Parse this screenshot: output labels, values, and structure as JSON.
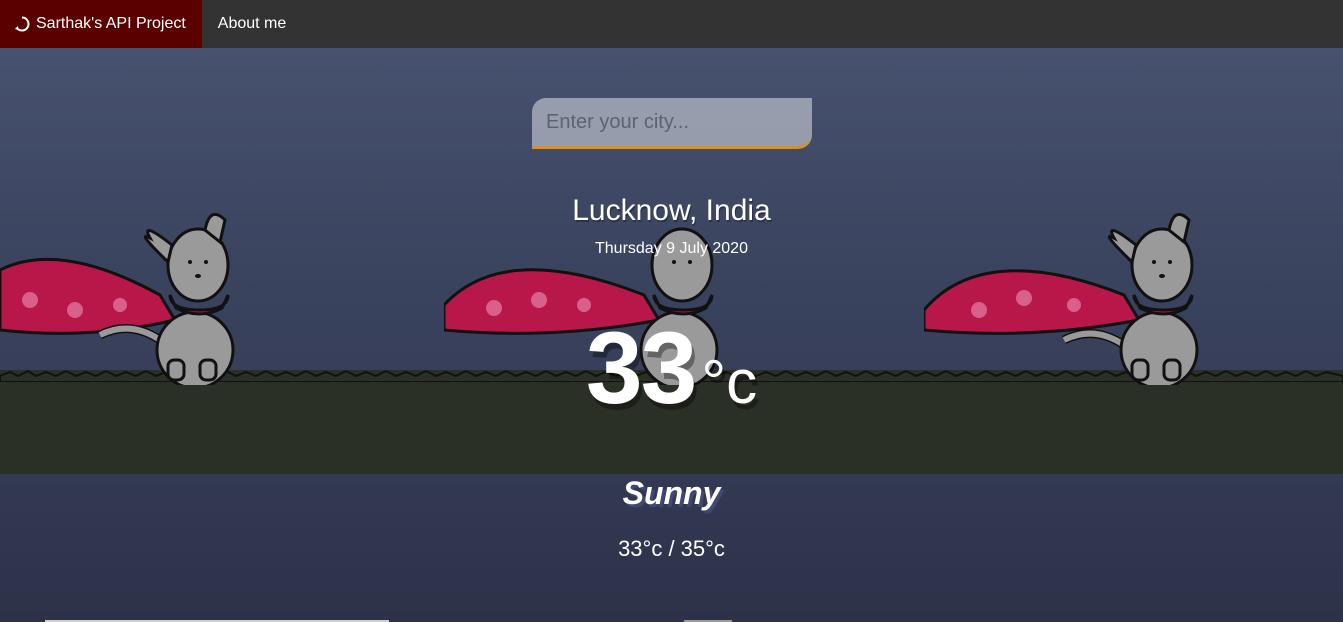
{
  "nav": {
    "brand_label": "Sarthak's API Project",
    "brand_icon": "refresh-circle-icon",
    "about_label": "About me"
  },
  "search": {
    "placeholder": "Enter your city...",
    "value": ""
  },
  "weather": {
    "location": "Lucknow, India",
    "date": "Thursday 9 July 2020",
    "temperature": "33",
    "unit": "°c",
    "condition": "Sunny",
    "hi_low": "33°c / 35°c"
  },
  "colors": {
    "navbar": "#333333",
    "brand_bg": "#5a0000",
    "search_accent": "#df8e1d",
    "scarf": "#b8174a",
    "grass": "#2b3026"
  }
}
